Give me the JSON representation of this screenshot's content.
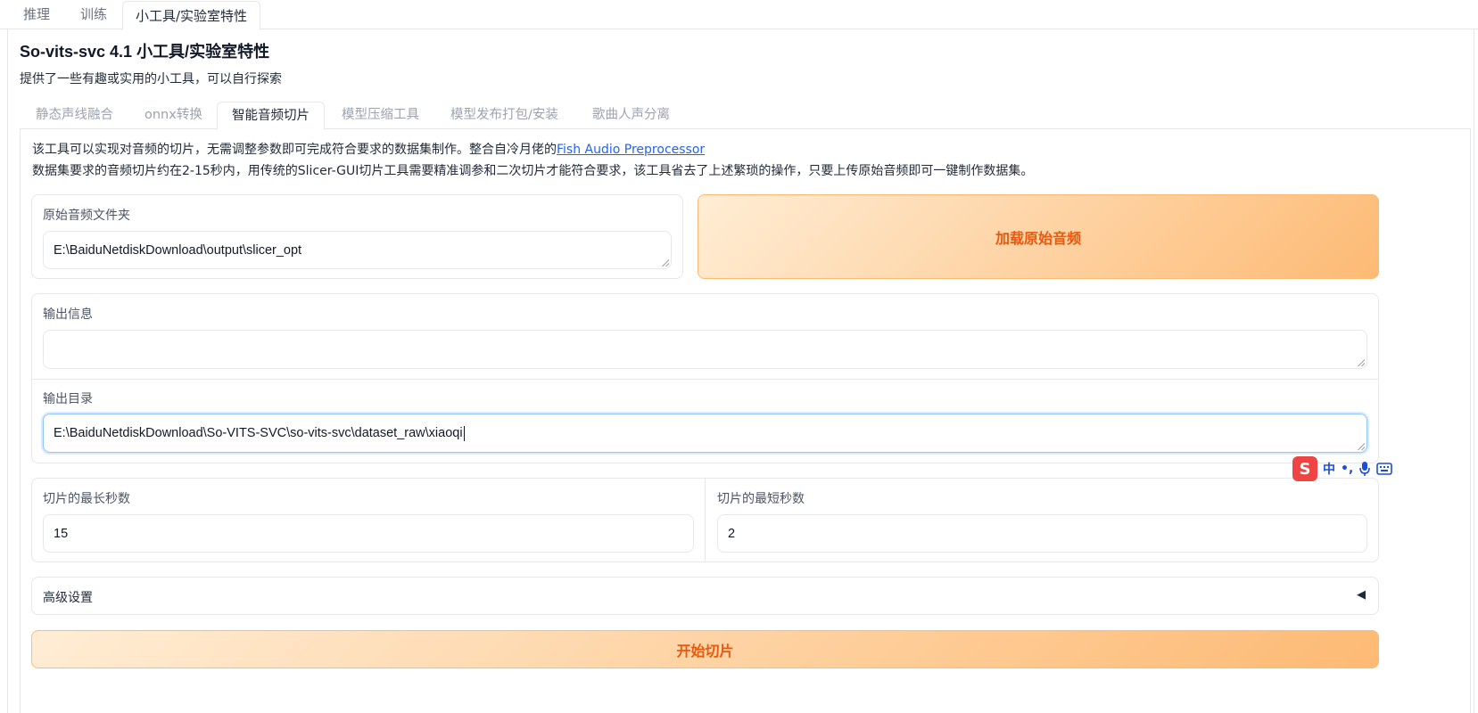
{
  "top_tabs": [
    {
      "label": "推理"
    },
    {
      "label": "训练"
    },
    {
      "label": "小工具/实验室特性"
    }
  ],
  "page": {
    "title": "So-vits-svc 4.1 小工具/实验室特性",
    "description": "提供了一些有趣或实用的小工具，可以自行探索"
  },
  "sub_tabs": [
    {
      "label": "静态声线融合"
    },
    {
      "label": "onnx转换"
    },
    {
      "label": "智能音频切片"
    },
    {
      "label": "模型压缩工具"
    },
    {
      "label": "模型发布打包/安装"
    },
    {
      "label": "歌曲人声分离"
    }
  ],
  "info": {
    "line1_text": "该工具可以实现对音频的切片，无需调整参数即可完成符合要求的数据集制作。整合自冷月佬的",
    "line1_link": "Fish Audio Preprocessor",
    "line2_text": "数据集要求的音频切片约在2-15秒内，用传统的Slicer-GUI切片工具需要精准调参和二次切片才能符合要求，该工具省去了上述繁琐的操作，只要上传原始音频即可一键制作数据集。"
  },
  "input_folder": {
    "label": "原始音频文件夹",
    "value": "E:\\BaiduNetdiskDownload\\output\\slicer_opt"
  },
  "load_button": {
    "label": "加载原始音频"
  },
  "output_info": {
    "label": "输出信息",
    "value": ""
  },
  "output_dir": {
    "label": "输出目录",
    "value": "E:\\BaiduNetdiskDownload\\So-VITS-SVC\\so-vits-svc\\dataset_raw\\xiaoqi"
  },
  "max_seconds": {
    "label": "切片的最长秒数",
    "value": "15"
  },
  "min_seconds": {
    "label": "切片的最短秒数",
    "value": "2"
  },
  "advanced": {
    "label": "高级设置",
    "arrow": "◀"
  },
  "start_button": {
    "label": "开始切片"
  },
  "ime": {
    "logo": "S",
    "lang": "中",
    "punct": "•,"
  },
  "colors": {
    "accent": "#ea580c",
    "link": "#2563eb"
  }
}
